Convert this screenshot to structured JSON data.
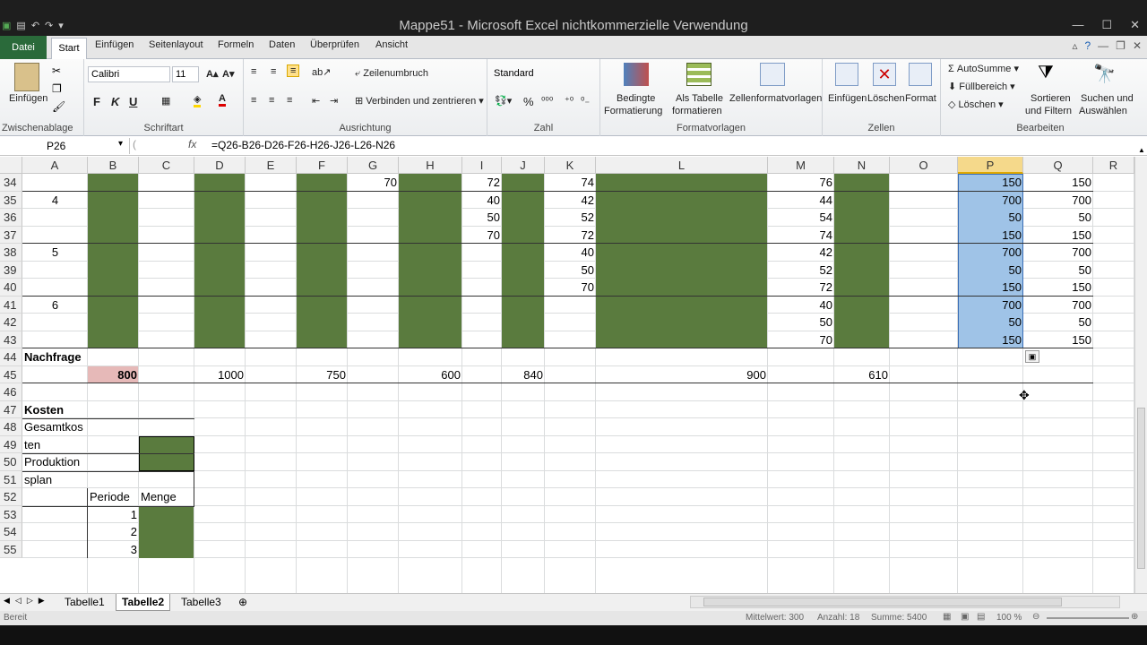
{
  "window": {
    "title": "Mappe51 - Microsoft Excel nichtkommerzielle Verwendung"
  },
  "ribbon_tabs": [
    "Datei",
    "Start",
    "Einfügen",
    "Seitenlayout",
    "Formeln",
    "Daten",
    "Überprüfen",
    "Ansicht"
  ],
  "ribbon": {
    "clipboard": {
      "paste": "Einfügen",
      "group": "Zwischenablage"
    },
    "font": {
      "name": "Calibri",
      "size": "11",
      "group": "Schriftart",
      "bold": "F",
      "italic": "K",
      "underline": "U"
    },
    "alignment": {
      "wrap": "Zeilenumbruch",
      "merge": "Verbinden und zentrieren",
      "group": "Ausrichtung"
    },
    "number": {
      "format": "Standard",
      "group": "Zahl",
      "percent": "%"
    },
    "styles": {
      "cond_line1": "Bedingte",
      "cond_line2": "Formatierung",
      "table_line1": "Als Tabelle",
      "table_line2": "formatieren",
      "cellstyles": "Zellenformatvorlagen",
      "group": "Formatvorlagen"
    },
    "cells": {
      "insert": "Einfügen",
      "delete": "Löschen",
      "format": "Format",
      "group": "Zellen"
    },
    "editing": {
      "autosum": "AutoSumme",
      "fill": "Füllbereich",
      "clear": "Löschen",
      "sort_line1": "Sortieren",
      "sort_line2": "und Filtern",
      "find_line1": "Suchen und",
      "find_line2": "Auswählen",
      "group": "Bearbeiten"
    }
  },
  "formula_bar": {
    "name_box": "P26",
    "fx": "fx",
    "formula": "=Q26-B26-D26-F26-H26-J26-L26-N26"
  },
  "columns": [
    "A",
    "B",
    "C",
    "D",
    "E",
    "F",
    "G",
    "H",
    "I",
    "J",
    "K",
    "L",
    "M",
    "N",
    "O",
    "P",
    "Q",
    "R"
  ],
  "rows": [
    "34",
    "35",
    "36",
    "37",
    "38",
    "39",
    "40",
    "41",
    "42",
    "43",
    "44",
    "45",
    "46",
    "47",
    "48",
    "49",
    "50",
    "51",
    "52",
    "53",
    "54",
    "55"
  ],
  "cells": {
    "A35": "4",
    "A38": "5",
    "A41": "6",
    "G34": "70",
    "I34": "72",
    "I35": "40",
    "I36": "50",
    "I37": "70",
    "K34": "74",
    "K35": "42",
    "K36": "52",
    "K37": "72",
    "K38": "40",
    "K39": "50",
    "K40": "70",
    "M34": "76",
    "M35": "44",
    "M36": "54",
    "M37": "74",
    "M38": "42",
    "M39": "52",
    "M40": "72",
    "M41": "40",
    "M42": "50",
    "M43": "70",
    "P34": "150",
    "P35": "700",
    "P36": "50",
    "P37": "150",
    "P38": "700",
    "P39": "50",
    "P40": "150",
    "P41": "700",
    "P42": "50",
    "P43": "150",
    "Q34": "150",
    "Q35": "700",
    "Q36": "50",
    "Q37": "150",
    "Q38": "700",
    "Q39": "50",
    "Q40": "150",
    "Q41": "700",
    "Q42": "50",
    "Q43": "150",
    "A44": "Nachfrage",
    "B45": "800",
    "D45": "1000",
    "F45": "750",
    "H45": "600",
    "J45": "840",
    "L45": "900",
    "N45": "610",
    "A47": "Kosten",
    "A49a": "Gesamtkos",
    "A49b": "ten",
    "A51a": "Produktion",
    "A51b": "splan",
    "B52": "Periode",
    "C52": "Menge",
    "B53": "1",
    "B54": "2",
    "B55": "3"
  },
  "sheets": [
    "Tabelle1",
    "Tabelle2",
    "Tabelle3"
  ],
  "active_sheet": "Tabelle2",
  "status": {
    "ready": "Bereit",
    "average": "Mittelwert: 300",
    "count": "Anzahl: 18",
    "sum": "Summe: 5400",
    "zoom": "100 %"
  },
  "colors": {
    "green_fill": "#5a7b3e",
    "selection": "#9fc3e7",
    "file_tab": "#2a6a3a"
  }
}
